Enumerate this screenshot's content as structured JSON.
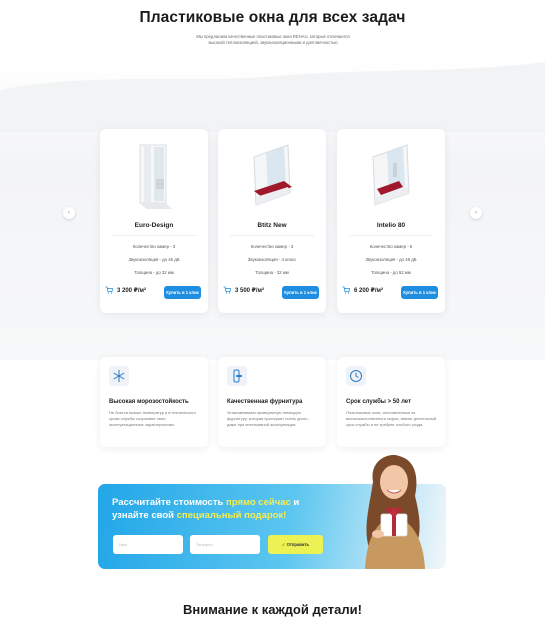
{
  "header": {
    "title": "Пластиковые окна для всех задач",
    "subtitle": "Мы предлагаем качественные пластиковые окна REHAU, которые отличаются высокой теплоизоляцией, звукоизоляционными и долговечностью"
  },
  "carousel": {
    "prev_icon": "chevron-left-icon",
    "next_icon": "chevron-right-icon",
    "prev_label": "‹",
    "next_label": "›"
  },
  "products": [
    {
      "name": "Euro-Design",
      "specs": [
        "Количество камер - 3",
        "Звукоизоляция - до 45 дБ",
        "Толщина - до 32 мм"
      ],
      "price": "3 200 ₽/м²",
      "buy_label": "Купить в 1 клик",
      "frame_color": "#ffffff"
    },
    {
      "name": "Btitz New",
      "specs": [
        "Количество камер - 3",
        "Звукоизоляция - 4 класс",
        "Толщина - 32 мм"
      ],
      "price": "3 500 ₽/м²",
      "buy_label": "Купить в 1 клик",
      "frame_color": "#ffffff"
    },
    {
      "name": "Intelio 80",
      "specs": [
        "Количество камер - 6",
        "Звукоизоляция - до 48 дБ",
        "Толщина - до 52 мм"
      ],
      "price": "6 200 ₽/м²",
      "buy_label": "Купить в 1 клик",
      "frame_color": "#ffffff"
    }
  ],
  "features": [
    {
      "icon": "snowflake-icon",
      "title": "Высокая морозостойкость",
      "text": "Не боятся низких температур и в технического срока службы сохраняют свои эксплуатационные характеристики."
    },
    {
      "icon": "window-handle-icon",
      "title": "Качественная фурнитура",
      "text": "Устанавливаем проверенную немецкую фурнитуру, которая прослужит очень долго, даже при интенсивной эксплуатации."
    },
    {
      "icon": "clock-icon",
      "title": "Срок службы > 50 лет",
      "text": "Пластиковые окна, изготовленные из высококачественного сырья, имеют длительный срок службы и не требуют особого ухода."
    }
  ],
  "cta": {
    "line1_a": "Рассчитайте стоимость ",
    "line1_highlight": "прямо сейчас",
    "line1_b": " и",
    "line2_a": "узнайте свой ",
    "line2_highlight": "специальный подарок!",
    "input1_placeholder": "Имя",
    "input2_placeholder": "Телефон",
    "submit_label": "✓ Отправить"
  },
  "section2": {
    "title": "Внимание к каждой детали!"
  },
  "colors": {
    "accent": "#1f8ee0",
    "highlight": "#f6ee4e",
    "submit": "#ecf253",
    "frame_red": "#a0182b"
  }
}
